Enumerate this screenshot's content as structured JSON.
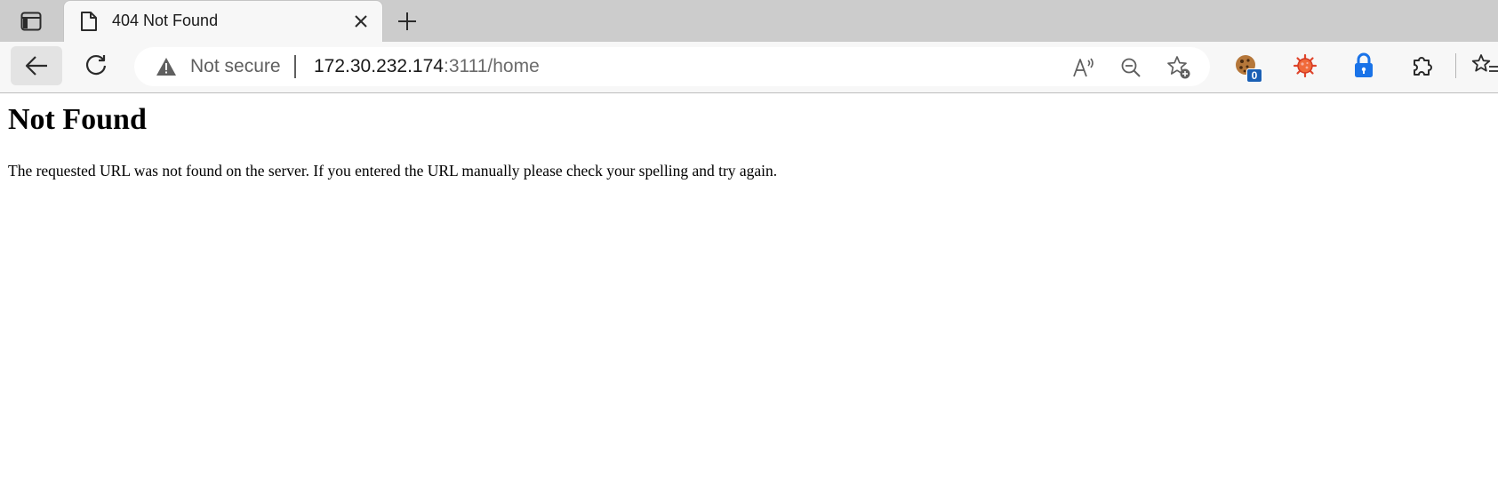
{
  "browser": {
    "tab": {
      "title": "404 Not Found",
      "favicon": "page-icon"
    },
    "address_bar": {
      "security_label": "Not secure",
      "url_host": "172.30.232.174",
      "url_rest": ":3111/home"
    },
    "extensions": {
      "cookie_badge": "0"
    }
  },
  "page": {
    "heading": "Not Found",
    "message": "The requested URL was not found on the server. If you entered the URL manually please check your spelling and try again."
  }
}
